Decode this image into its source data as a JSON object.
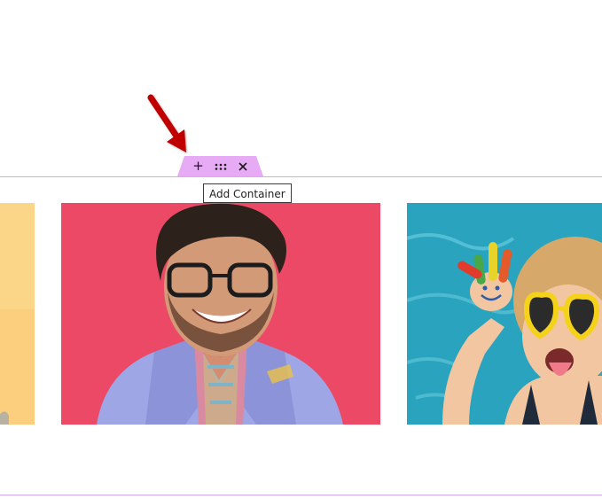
{
  "section_toolbar": {
    "add_label": "+",
    "tooltip": "Add Container",
    "icons": [
      "plus-icon",
      "drag-handle-icon",
      "close-icon"
    ]
  },
  "colors": {
    "accent_outline": "#d9a6f0",
    "handle_tab": "#e7aaf5",
    "annotation_arrow": "#c00000"
  },
  "gallery": {
    "images": [
      {
        "name": "yellow-photo-partial",
        "alt": ""
      },
      {
        "name": "smiling-man-photo",
        "alt": ""
      },
      {
        "name": "child-painted-hand-photo",
        "alt": ""
      }
    ]
  }
}
